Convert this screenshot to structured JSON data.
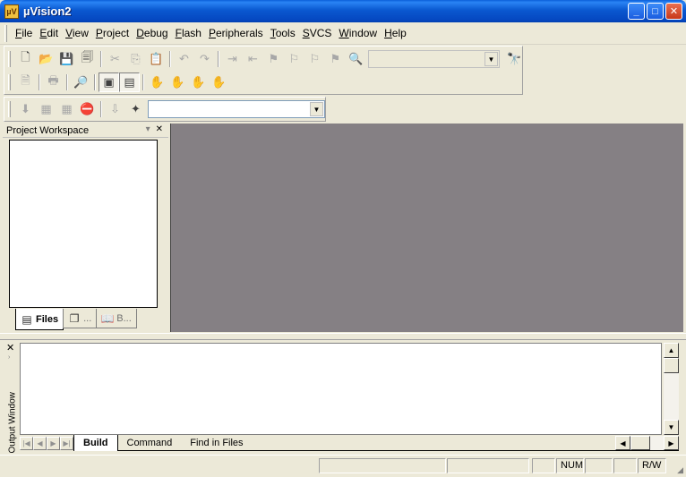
{
  "window": {
    "title": "µVision2"
  },
  "menu": [
    "File",
    "Edit",
    "View",
    "Project",
    "Debug",
    "Flash",
    "Peripherals",
    "Tools",
    "SVCS",
    "Window",
    "Help"
  ],
  "toolbar": {
    "find_combo_value": "",
    "target_combo_value": ""
  },
  "workspace": {
    "title": "Project Workspace",
    "tabs": [
      {
        "label": "Files"
      },
      {
        "label": "..."
      },
      {
        "label": "B..."
      }
    ]
  },
  "output": {
    "label": "Output Window",
    "tabs": [
      "Build",
      "Command",
      "Find in Files"
    ]
  },
  "status": {
    "num": "NUM",
    "rw": "R/W"
  }
}
